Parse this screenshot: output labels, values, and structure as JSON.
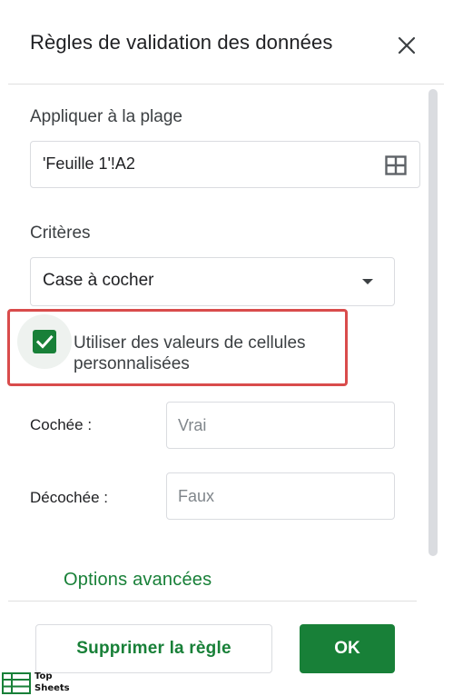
{
  "dialog": {
    "title": "Règles de validation des données",
    "close_icon": "close-icon"
  },
  "range": {
    "label": "Appliquer à la plage",
    "value": "'Feuille 1'!A2",
    "icon": "grid-select-icon"
  },
  "criteria": {
    "label": "Critères",
    "selected": "Case à cocher",
    "icon": "dropdown-arrow-icon"
  },
  "custom_values": {
    "checked": true,
    "label": "Utiliser des valeurs de cellules personnalisées",
    "highlight_color": "#d94c4c"
  },
  "checked_field": {
    "label": "Cochée :",
    "placeholder": "Vrai",
    "value": ""
  },
  "unchecked_field": {
    "label": "Décochée :",
    "placeholder": "Faux",
    "value": ""
  },
  "advanced": {
    "label": "Options avancées"
  },
  "footer": {
    "delete_label": "Supprimer la règle",
    "ok_label": "OK"
  },
  "watermark": {
    "line1": "Top",
    "line2": "Sheets"
  },
  "colors": {
    "accent": "#188038",
    "border": "#dadce0",
    "text": "#202124"
  }
}
